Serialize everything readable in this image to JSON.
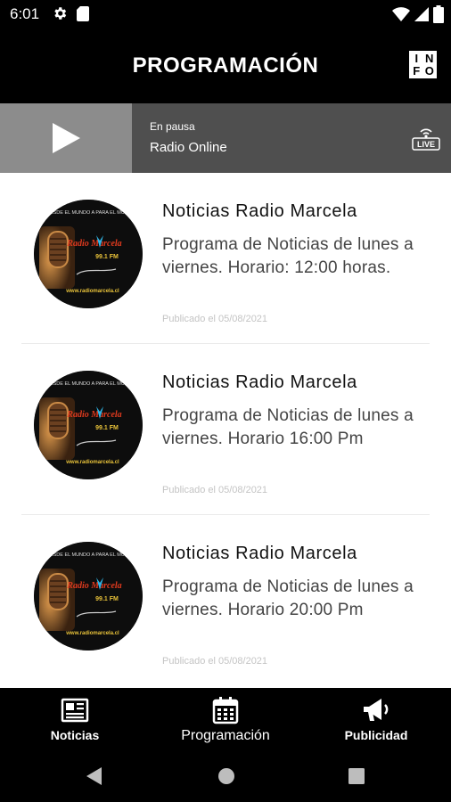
{
  "status_bar": {
    "time": "6:01",
    "icons": [
      "gear-icon",
      "sd-card-icon",
      "wifi-icon",
      "signal-icon",
      "battery-icon"
    ]
  },
  "app_bar": {
    "title": "PROGRAMACIÓN",
    "info_button": {
      "letters": [
        "I",
        "N",
        "F",
        "O"
      ]
    }
  },
  "player": {
    "status": "En pausa",
    "station": "Radio Online",
    "play_icon": "play-icon",
    "live_badge": "LIVE"
  },
  "programs": [
    {
      "title": "Noticias Radio Marcela",
      "description": "Programa de Noticias de lunes a viernes. Horario: 12:00 horas.",
      "date": "Publicado el 05/08/2021"
    },
    {
      "title": "Noticias Radio Marcela",
      "description": "Programa de Noticias de lunes a viernes. Horario 16:00 Pm",
      "date": "Publicado el 05/08/2021"
    },
    {
      "title": "Noticias Radio Marcela",
      "description": "Programa de Noticias de lunes a viernes. Horario 20:00 Pm",
      "date": "Publicado el 05/08/2021"
    }
  ],
  "bottom_nav": [
    {
      "label": "Noticias",
      "icon": "newspaper-icon"
    },
    {
      "label": "Programación",
      "icon": "calendar-icon",
      "active": true
    },
    {
      "label": "Publicidad",
      "icon": "megaphone-icon"
    }
  ],
  "logo": {
    "top_text": "DESDE EL MUNDO A PARA EL MUNDO",
    "brand": "Radio Marcela",
    "freq": "99.1 FM",
    "url": "www.radiomarcela.cl"
  },
  "colors": {
    "background": "#000000",
    "player_bg": "#4f4f4f",
    "play_area_bg": "#8c8c8c",
    "list_bg": "#ffffff",
    "logo_accent": "#e03a1e",
    "logo_butterfly": "#2fb6e6"
  }
}
